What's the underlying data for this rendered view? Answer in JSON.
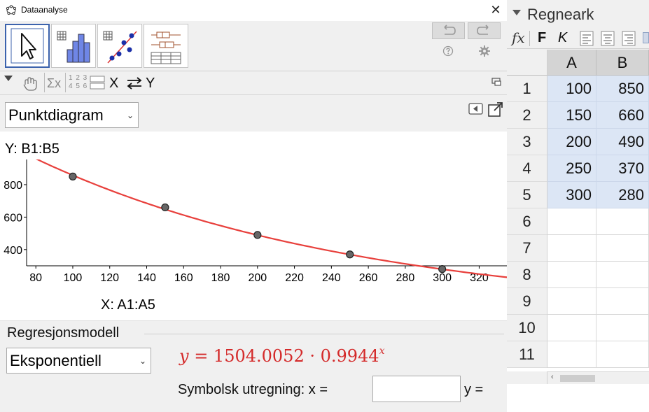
{
  "dataanalyse": {
    "title": "Dataanalyse",
    "close_label": "✕",
    "tools": [
      {
        "name": "move-tool",
        "selected": true
      },
      {
        "name": "one-variable-analysis"
      },
      {
        "name": "two-variable-regression"
      },
      {
        "name": "multi-variable-analysis"
      }
    ],
    "toolbar2": {
      "hand": "hand-icon",
      "sum": "Σx",
      "numbers_top": "1 2 3",
      "numbers_bottom": "4 5 6",
      "swap_x": "X",
      "swap_y": "Y"
    },
    "plot_type": "Punktdiagram",
    "y_label": "Y:  B1:B5",
    "x_label": "X:  A1:A5",
    "regression": {
      "title": "Regresjonsmodell",
      "model": "Eksponentiell",
      "formula_y": "y",
      "formula_eq": " = 1504.0052 · 0.9944",
      "formula_exp": "x",
      "symbolic_label": "Symbolsk utregning:  x =",
      "x_value": "",
      "y_label": "y ="
    }
  },
  "regneark": {
    "title": "Regneark",
    "format_f": "F",
    "format_k": "K",
    "columns": [
      "A",
      "B"
    ],
    "rows": [
      "1",
      "2",
      "3",
      "4",
      "5",
      "6",
      "7",
      "8",
      "9",
      "10",
      "11"
    ],
    "data": [
      [
        "100",
        "850"
      ],
      [
        "150",
        "660"
      ],
      [
        "200",
        "490"
      ],
      [
        "250",
        "370"
      ],
      [
        "300",
        "280"
      ]
    ]
  },
  "chart_data": {
    "type": "scatter",
    "x": [
      100,
      150,
      200,
      250,
      300
    ],
    "y": [
      850,
      660,
      490,
      370,
      280
    ],
    "xlim": [
      75,
      335
    ],
    "ylim": [
      300,
      955
    ],
    "xticks": [
      80,
      100,
      120,
      140,
      160,
      180,
      200,
      220,
      240,
      260,
      280,
      300,
      320
    ],
    "yticks": [
      400,
      600,
      800
    ],
    "regression": {
      "model": "exponential",
      "a": 1504.0052,
      "b": 0.9944
    },
    "point_color": "#666666",
    "curve_color": "#e8403c"
  }
}
